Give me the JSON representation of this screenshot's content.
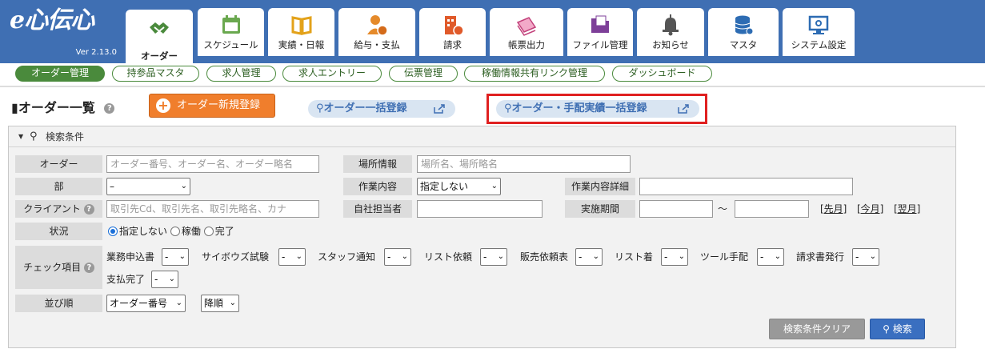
{
  "app": {
    "logo_text": "e心伝心",
    "version": "Ver 2.13.0"
  },
  "nav": [
    {
      "label": "オーダー",
      "icon": "handshake-icon"
    },
    {
      "label": "スケジュール",
      "icon": "calendar-icon"
    },
    {
      "label": "実績・日報",
      "icon": "book-icon"
    },
    {
      "label": "給与・支払",
      "icon": "payroll-icon"
    },
    {
      "label": "請求",
      "icon": "building-invoice-icon"
    },
    {
      "label": "帳票出力",
      "icon": "documents-icon"
    },
    {
      "label": "ファイル管理",
      "icon": "folder-icon"
    },
    {
      "label": "お知らせ",
      "icon": "bell-icon"
    },
    {
      "label": "マスタ",
      "icon": "database-icon"
    },
    {
      "label": "システム設定",
      "icon": "monitor-settings-icon"
    }
  ],
  "subnav": [
    "オーダー管理",
    "持参品マスタ",
    "求人管理",
    "求人エントリー",
    "伝票管理",
    "稼働情報共有リンク管理",
    "ダッシュボード"
  ],
  "page": {
    "title": "オーダー一覧",
    "new_button": "オーダー新規登録",
    "bulk_link": "オーダー一括登録",
    "bulk_arrange_link": "オーダー・手配実績一括登録"
  },
  "search": {
    "header": "検索条件",
    "order_label": "オーダー",
    "order_placeholder": "オーダー番号、オーダー名、オーダー略名",
    "place_label": "場所情報",
    "place_placeholder": "場所名、場所略名",
    "dept_label": "部",
    "dept_value": "–",
    "work_label": "作業内容",
    "work_value": "指定しない",
    "work_detail_label": "作業内容詳細",
    "client_label": "クライアント",
    "client_placeholder": "取引先Cd、取引先名、取引先略名、カナ",
    "staff_label": "自社担当者",
    "period_label": "実施期間",
    "period_sep": "～",
    "prev_month": "[先月]",
    "this_month": "[今月]",
    "next_month": "[翌月]",
    "status_label": "状況",
    "status_options": [
      "指定しない",
      "稼働",
      "完了"
    ],
    "check_label": "チェック項目",
    "checks": [
      "業務申込書",
      "サイボウズ試験",
      "スタッフ通知",
      "リスト依頼",
      "販売依頼表",
      "リスト着",
      "ツール手配",
      "請求書発行",
      "支払完了"
    ],
    "check_value": "-",
    "sort_label": "並び順",
    "sort_value": "オーダー番号",
    "order_dir_value": "降順",
    "clear_button": "検索条件クリア",
    "search_button": "検索"
  }
}
